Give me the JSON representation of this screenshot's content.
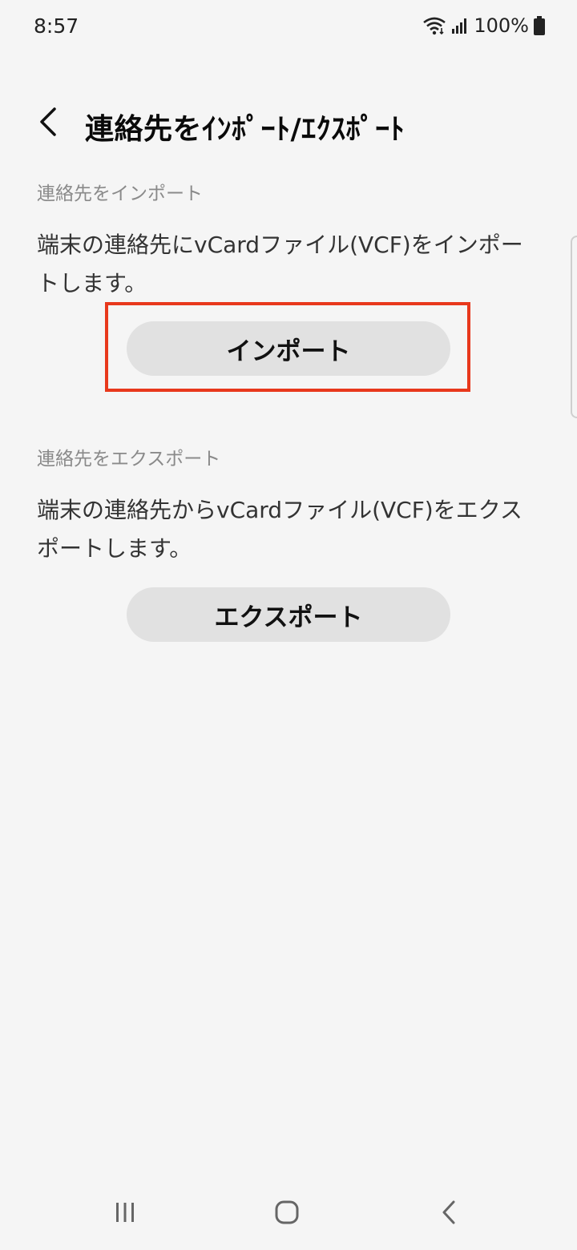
{
  "status_bar": {
    "time": "8:57",
    "battery": "100%",
    "icons": [
      "wifi-icon",
      "signal-icon",
      "battery-icon"
    ]
  },
  "app_bar": {
    "back_icon": "chevron-left-icon",
    "title": "連絡先をｲﾝﾎﾟｰﾄ/ｴｸｽﾎﾟｰﾄ"
  },
  "import_section": {
    "header": "連絡先をインポート",
    "description": "端末の連絡先にvCardファイル(VCF)をインポートします。",
    "button_label": "インポート"
  },
  "export_section": {
    "header": "連絡先をエクスポート",
    "description": "端末の連絡先からvCardファイル(VCF)をエクスポートします。",
    "button_label": "エクスポート"
  },
  "nav_bar": {
    "icons": [
      "recents-icon",
      "home-icon",
      "back-icon"
    ]
  },
  "colors": {
    "background": "#f5f5f5",
    "button": "#e1e1e1",
    "highlight": "#e8381c"
  }
}
